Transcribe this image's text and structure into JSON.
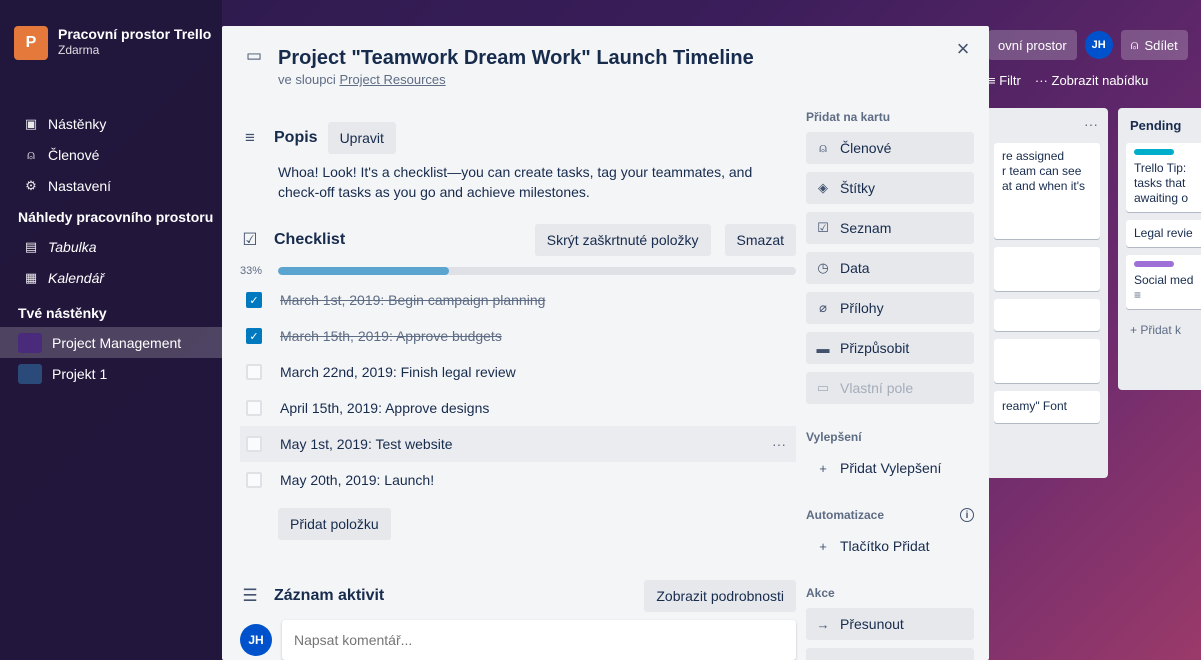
{
  "workspace": {
    "initial": "P",
    "name": "Pracovní prostor Trello",
    "plan": "Zdarma"
  },
  "sidebar": {
    "items": [
      {
        "label": "Nástěnky",
        "icon": "board-icon"
      },
      {
        "label": "Členové",
        "icon": "person-icon"
      },
      {
        "label": "Nastavení",
        "icon": "gear-icon"
      }
    ],
    "views_heading": "Náhledy pracovního prostoru",
    "views": [
      {
        "label": "Tabulka",
        "icon": "table-icon"
      },
      {
        "label": "Kalendář",
        "icon": "calendar-icon"
      }
    ],
    "boards_heading": "Tvé nástěnky",
    "boards": [
      {
        "label": "Project Management",
        "color": "#4a2a7a",
        "active": true
      },
      {
        "label": "Projekt 1",
        "color": "#2a4a7a",
        "active": false
      }
    ]
  },
  "board": {
    "workspace_btn": "ovní prostor",
    "avatar": "JH",
    "share_btn": "Sdílet",
    "filter": "Filtr",
    "show_menu": "Zobrazit nabídku",
    "list_a": {
      "menu": "···",
      "cards": [
        "re assigned",
        "r team can see",
        "at and when it's",
        "reamy\" Font"
      ]
    },
    "list_b": {
      "title": "Pending",
      "cards": [
        "Trello Tip:",
        "tasks that",
        "awaiting o",
        "Legal revie",
        "Social med",
        "+ Přidat k"
      ]
    }
  },
  "card": {
    "title": "Project \"Teamwork Dream Work\" Launch Timeline",
    "in_list_prefix": "ve sloupci",
    "in_list_name": "Project Resources",
    "close": "×",
    "description": {
      "heading": "Popis",
      "edit_btn": "Upravit",
      "text": "Whoa! Look! It's a checklist—you can create tasks, tag your teammates, and check-off tasks as you go and achieve milestones."
    },
    "checklist": {
      "heading": "Checklist",
      "hide_btn": "Skrýt zaškrtnuté položky",
      "delete_btn": "Smazat",
      "progress_label": "33%",
      "progress": 0.33,
      "items": [
        {
          "text": "March 1st, 2019: Begin campaign planning",
          "done": true
        },
        {
          "text": "March 15th, 2019: Approve budgets",
          "done": true
        },
        {
          "text": "March 22nd, 2019: Finish legal review",
          "done": false
        },
        {
          "text": "April 15th, 2019: Approve designs",
          "done": false
        },
        {
          "text": "May 1st, 2019: Test website",
          "done": false
        },
        {
          "text": "May 20th, 2019: Launch!",
          "done": false
        }
      ],
      "add_btn": "Přidat položku"
    },
    "activity": {
      "heading": "Záznam aktivit",
      "details_btn": "Zobrazit podrobnosti",
      "avatar": "JH",
      "comment_placeholder": "Napsat komentář..."
    },
    "side": {
      "add_heading": "Přidat na kartu",
      "add_items": [
        {
          "label": "Členové",
          "icon": "person-icon"
        },
        {
          "label": "Štítky",
          "icon": "tag-icon"
        },
        {
          "label": "Seznam",
          "icon": "checklist-icon"
        },
        {
          "label": "Data",
          "icon": "clock-icon"
        },
        {
          "label": "Přílohy",
          "icon": "paperclip-icon"
        },
        {
          "label": "Přizpůsobit",
          "icon": "card-cover-icon"
        },
        {
          "label": "Vlastní pole",
          "icon": "custom-field-icon"
        }
      ],
      "powerups_heading": "Vylepšení",
      "powerups_btn": "Přidat Vylepšení",
      "automation_heading": "Automatizace",
      "automation_btn": "Tlačítko Přidat",
      "actions_heading": "Akce",
      "move_btn": "Přesunout"
    }
  }
}
